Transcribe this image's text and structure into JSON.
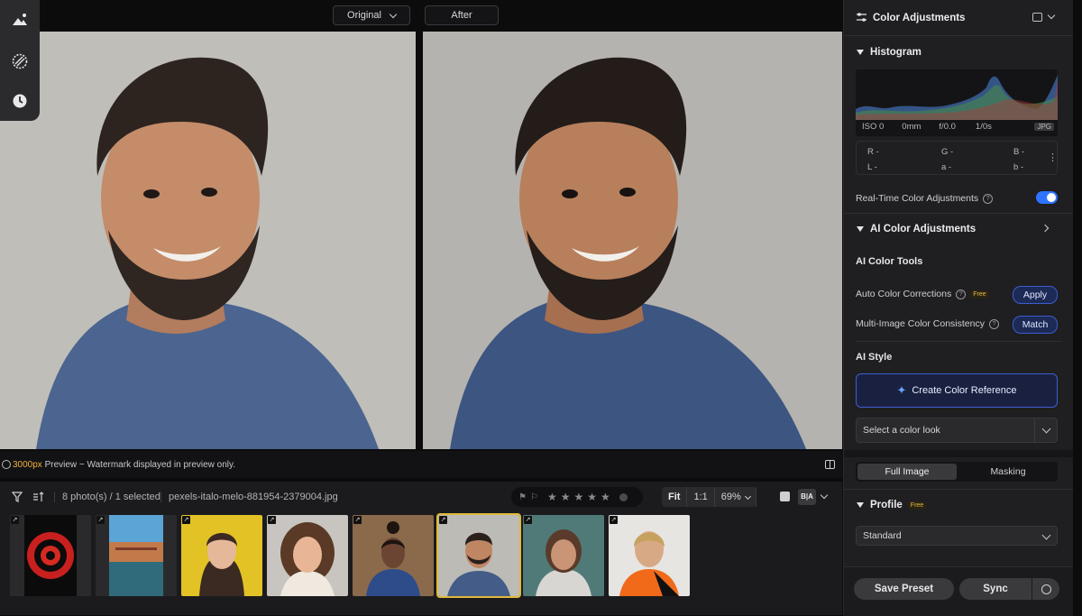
{
  "view": {
    "original_label": "Original",
    "after_label": "After"
  },
  "status": {
    "resolution": "3000px",
    "preview_text": " Preview ~ Watermark displayed in preview only."
  },
  "filmbar": {
    "count_text": "8 photo(s) / 1 selected",
    "filename": "pexels-italo-melo-881954-2379004.jpg",
    "zoom_fit": "Fit",
    "zoom_one": "1:1",
    "zoom_value": "69%",
    "ba_label": "B|A",
    "rating_stars": 5
  },
  "thumbnails": [
    {
      "name": "spiral-staircase"
    },
    {
      "name": "waterfront-buildings"
    },
    {
      "name": "woman-yellow-background"
    },
    {
      "name": "woman-smiling-curly-hair"
    },
    {
      "name": "woman-blue-blazer"
    },
    {
      "name": "man-smiling-selected"
    },
    {
      "name": "woman-glasses-studio"
    },
    {
      "name": "woman-orange-top"
    }
  ],
  "panel": {
    "title": "Color Adjustments",
    "histogram": {
      "title": "Histogram",
      "iso": "ISO 0",
      "focal": "0mm",
      "aperture": "f/0.0",
      "shutter": "1/0s",
      "format": "JPG",
      "r": "R -",
      "g": "G -",
      "b": "B -",
      "l": "L -",
      "a": "a -",
      "bb": "b -"
    },
    "realtime_label": "Real-Time Color Adjustments",
    "ai_section": "AI Color Adjustments",
    "ai_tools": "AI Color Tools",
    "auto_corrections": "Auto Color Corrections",
    "free_badge": "Free",
    "apply_label": "Apply",
    "consistency": "Multi-Image Color Consistency",
    "match_label": "Match",
    "ai_style": "AI Style",
    "create_ref": "Create Color Reference",
    "select_look": "Select a color look",
    "tab_full": "Full Image",
    "tab_masking": "Masking",
    "profile": "Profile",
    "profile_badge": "Free",
    "profile_value": "Standard",
    "save_preset": "Save Preset",
    "sync": "Sync"
  },
  "colors": {
    "accent_blue": "#2f73ff",
    "accent_gold": "#e0b93b"
  }
}
